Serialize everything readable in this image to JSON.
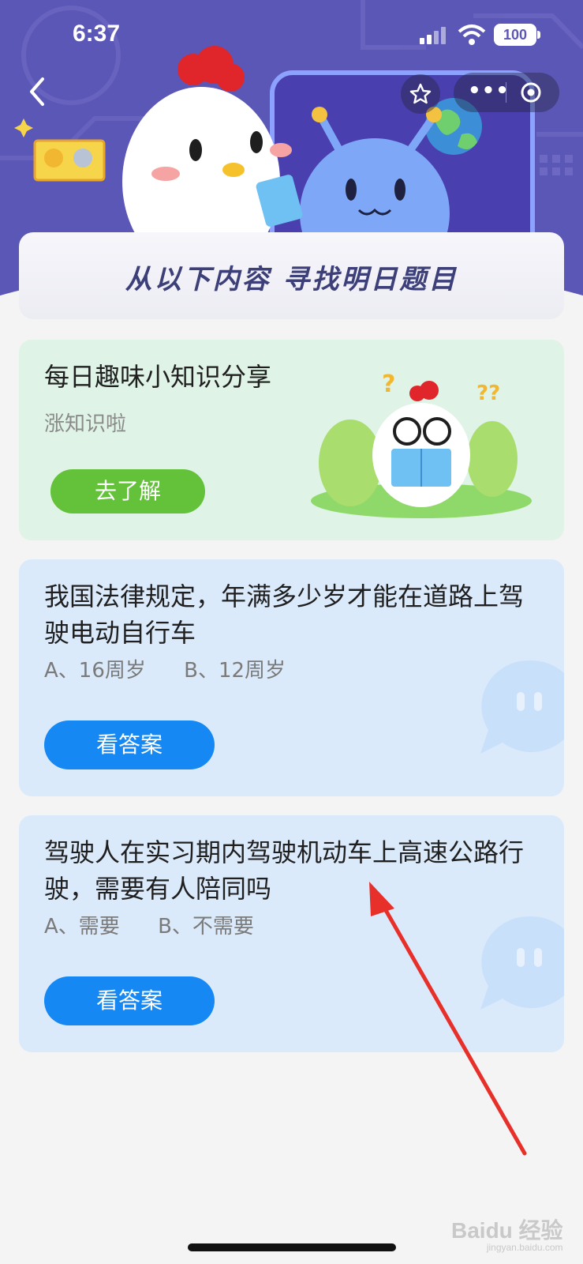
{
  "status_bar": {
    "time": "6:37",
    "battery": "100"
  },
  "header": {
    "title_card": "从以下内容 寻找明日题目",
    "colors": {
      "header_bg": "#5b57b6",
      "title": "#3c3f78"
    }
  },
  "cards": {
    "knowledge": {
      "title": "每日趣味小知识分享",
      "subtitle": "涨知识啦",
      "button": "去了解"
    },
    "questions": [
      {
        "question": "我国法律规定，年满多少岁才能在道路上驾驶电动自行车",
        "option_a": "A、16周岁",
        "option_b": "B、12周岁",
        "button": "看答案"
      },
      {
        "question": "驾驶人在实习期内驾驶机动车上高速公路行驶，需要有人陪同吗",
        "option_a": "A、需要",
        "option_b": "B、不需要",
        "button": "看答案"
      }
    ]
  },
  "watermark": {
    "brand": "Baidu 经验",
    "url": "jingyan.baidu.com"
  },
  "icons": [
    "back-arrow-icon",
    "star-icon",
    "more-dots-icon",
    "target-icon",
    "signal-icon",
    "wifi-icon",
    "battery-icon"
  ],
  "colors": {
    "accent_blue": "#1688f4",
    "accent_green": "#63c23a",
    "annotation_arrow": "#e8302a"
  }
}
